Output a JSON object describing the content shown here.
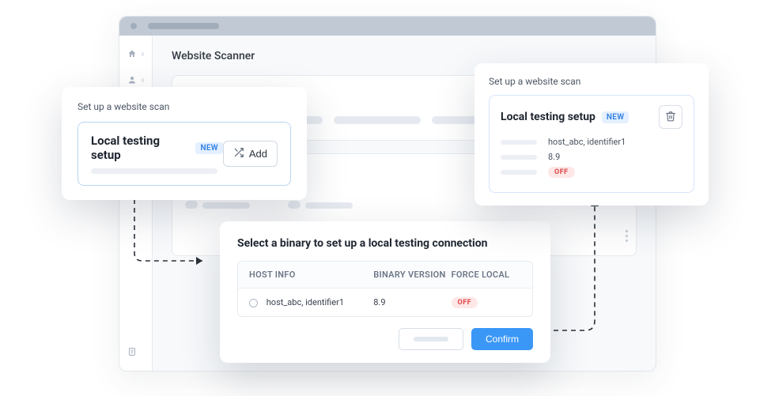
{
  "header": {
    "title": "Website Scanner"
  },
  "cardA": {
    "subhead": "Set up a website scan",
    "title": "Local testing setup",
    "badge": "NEW",
    "add_label": "Add"
  },
  "cardB": {
    "title": "Select a binary to set up a local testing connection",
    "columns": {
      "host": "HOST INFO",
      "version": "BINARY VERSION",
      "force": "FORCE LOCAL"
    },
    "row": {
      "host": "host_abc, identifier1",
      "version": "8.9",
      "force": "OFF"
    },
    "confirm_label": "Confirm"
  },
  "cardC": {
    "subhead": "Set up a website scan",
    "title": "Local testing setup",
    "badge": "NEW",
    "host": "host_abc, identifier1",
    "version": "8.9",
    "force": "OFF"
  }
}
